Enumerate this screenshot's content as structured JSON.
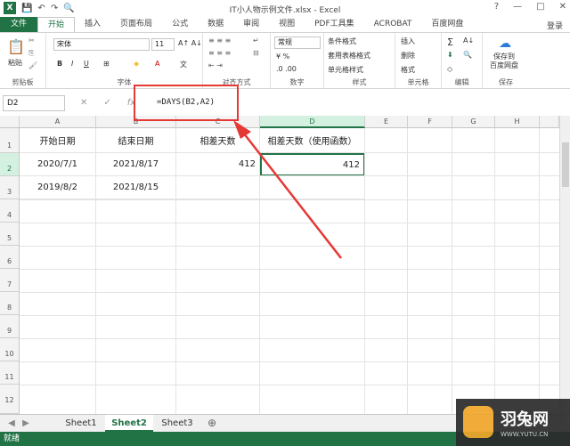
{
  "window": {
    "title": "IT小人物示例文件.xlsx - Excel",
    "controls": [
      "?",
      "—",
      "□",
      "✕"
    ]
  },
  "ribbon_tabs": [
    {
      "label": "文件"
    },
    {
      "label": "开始"
    },
    {
      "label": "插入"
    },
    {
      "label": "页面布局"
    },
    {
      "label": "公式"
    },
    {
      "label": "数据"
    },
    {
      "label": "审阅"
    },
    {
      "label": "视图"
    },
    {
      "label": "PDF工具集"
    },
    {
      "label": "ACROBAT"
    },
    {
      "label": "百度网盘"
    }
  ],
  "sign_in": "登录",
  "ribbon": {
    "paste": "粘贴",
    "clipboard": "剪贴板",
    "font_name": "宋体",
    "font_size": "11",
    "font_group": "字体",
    "align_group": "对齐方式",
    "number_format": "常规",
    "number_group": "数字",
    "cond_format": "条件格式",
    "table_format": "套用表格格式",
    "cell_style": "单元格样式",
    "style_group": "样式",
    "insert": "插入",
    "delete": "删除",
    "format": "格式",
    "cells_group": "单元格",
    "edit_group": "编辑",
    "save_baidu": "保存到\n百度网盘",
    "save_group": "保存"
  },
  "formula_bar": {
    "name_box": "D2",
    "formula": "=DAYS(B2,A2)"
  },
  "columns": [
    "A",
    "B",
    "C",
    "D",
    "E",
    "F",
    "G",
    "H"
  ],
  "rows": [
    "1",
    "2",
    "3",
    "4",
    "5",
    "6",
    "7",
    "8",
    "9",
    "10",
    "11",
    "12"
  ],
  "cells": {
    "A1": "开始日期",
    "B1": "结束日期",
    "C1": "相差天数",
    "D1": "相差天数（使用函数）",
    "A2": "2020/7/1",
    "B2": "2021/8/17",
    "C2": "412",
    "D2": "412",
    "A3": "2019/8/2",
    "B3": "2021/8/15"
  },
  "sheets": [
    {
      "label": "Sheet1"
    },
    {
      "label": "Sheet2"
    },
    {
      "label": "Sheet3"
    }
  ],
  "status": "就绪",
  "watermark": {
    "brand": "羽兔网",
    "url": "WWW.YUTU.CN"
  },
  "colors": {
    "excel_green": "#217346",
    "annotation_red": "#e53935"
  }
}
